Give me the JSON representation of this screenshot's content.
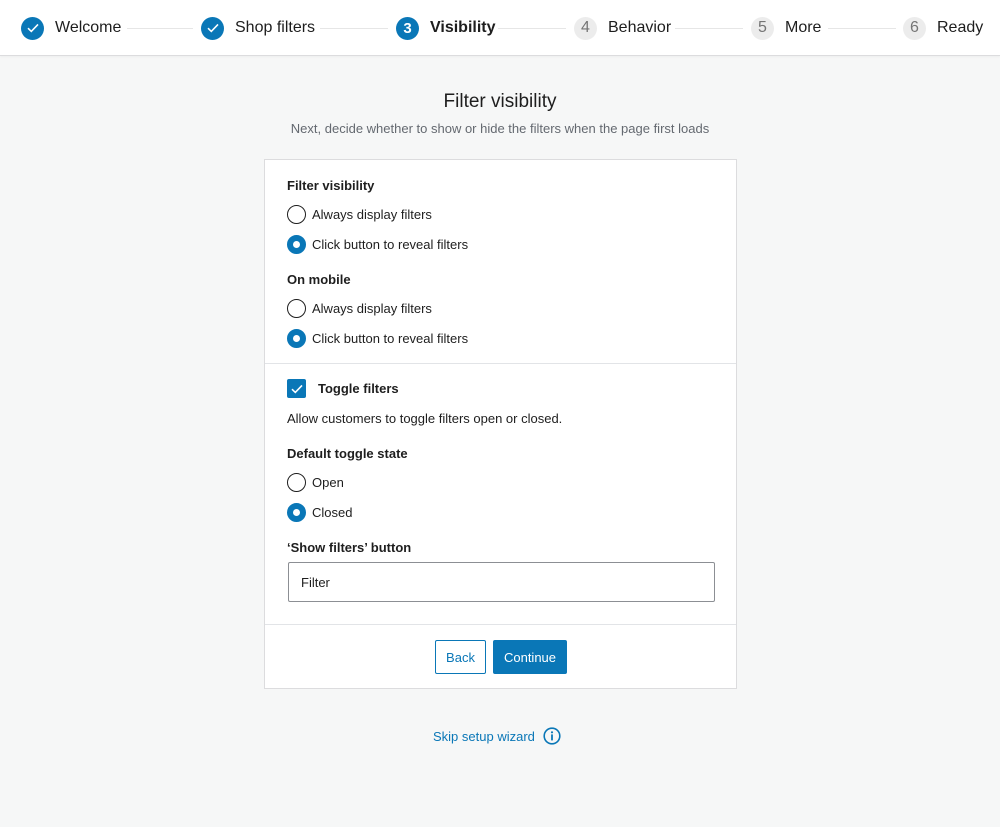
{
  "stepper": {
    "steps": [
      {
        "number": "1",
        "label": "Welcome",
        "status": "done",
        "icon": "check-icon"
      },
      {
        "number": "2",
        "label": "Shop filters",
        "status": "done",
        "icon": "check-icon"
      },
      {
        "number": "3",
        "label": "Visibility",
        "status": "active"
      },
      {
        "number": "4",
        "label": "Behavior",
        "status": "todo"
      },
      {
        "number": "5",
        "label": "More",
        "status": "todo"
      },
      {
        "number": "6",
        "label": "Ready",
        "status": "todo"
      }
    ]
  },
  "header": {
    "title": "Filter visibility",
    "subtitle": "Next, decide whether to show or hide the filters when the page first loads"
  },
  "form": {
    "filter_visibility": {
      "label": "Filter visibility",
      "options": [
        "Always display filters",
        "Click button to reveal filters"
      ],
      "selected": "Click button to reveal filters"
    },
    "on_mobile": {
      "label": "On mobile",
      "options": [
        "Always display filters",
        "Click button to reveal filters"
      ],
      "selected": "Click button to reveal filters"
    },
    "toggle_filters": {
      "label": "Toggle filters",
      "checked": true,
      "help": "Allow customers to toggle filters open or closed."
    },
    "default_toggle_state": {
      "label": "Default toggle state",
      "options": [
        "Open",
        "Closed"
      ],
      "selected": "Closed"
    },
    "show_filters_button": {
      "label": "‘Show filters’ button",
      "value": "Filter"
    }
  },
  "actions": {
    "back_label": "Back",
    "continue_label": "Continue"
  },
  "footer": {
    "skip_label": "Skip setup wizard",
    "icon": "info-icon"
  },
  "colors": {
    "accent": "#0a77b7",
    "background": "#f6f7f7"
  }
}
